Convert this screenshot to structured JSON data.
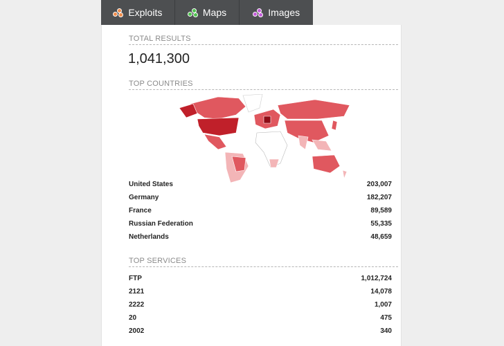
{
  "tabs": [
    {
      "label": "Exploits",
      "icon": "exploits-icon",
      "color": "#f08c4a"
    },
    {
      "label": "Maps",
      "icon": "maps-icon",
      "color": "#4fc24f"
    },
    {
      "label": "Images",
      "icon": "images-icon",
      "color": "#c35ad9"
    }
  ],
  "total_results": {
    "heading": "TOTAL RESULTS",
    "value": "1,041,300"
  },
  "top_countries": {
    "heading": "TOP COUNTRIES",
    "rows": [
      {
        "name": "United States",
        "count": "203,007"
      },
      {
        "name": "Germany",
        "count": "182,207"
      },
      {
        "name": "France",
        "count": "89,589"
      },
      {
        "name": "Russian Federation",
        "count": "55,335"
      },
      {
        "name": "Netherlands",
        "count": "48,659"
      }
    ]
  },
  "top_services": {
    "heading": "TOP SERVICES",
    "rows": [
      {
        "name": "FTP",
        "count": "1,012,724"
      },
      {
        "name": "2121",
        "count": "14,078"
      },
      {
        "name": "2222",
        "count": "1,007"
      },
      {
        "name": "20",
        "count": "475"
      },
      {
        "name": "2002",
        "count": "340"
      }
    ]
  },
  "colors": {
    "tab_bar": "#4d4f51",
    "map_dark": "#c0202a",
    "map_mid": "#e0585f",
    "map_light": "#f3b5b7"
  }
}
